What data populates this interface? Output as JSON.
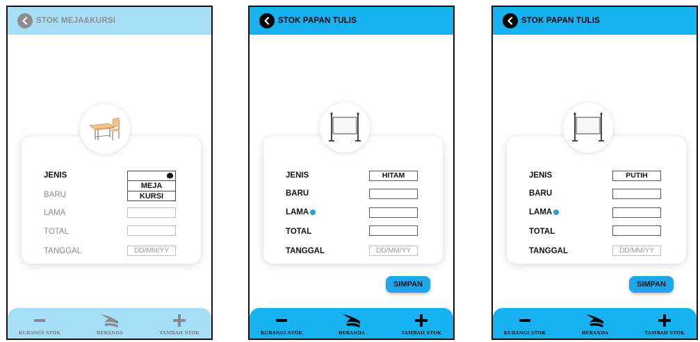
{
  "screens": [
    {
      "title": "STOK MEJA&KURSI",
      "labels": {
        "jenis": "JENIS",
        "baru": "BARU",
        "lama": "LAMA",
        "total": "TOTAL",
        "tanggal": "TANGGAL"
      },
      "jenis_options": [
        "MEJA",
        "KURSI"
      ],
      "tanggal_placeholder": "DD/MM/YY",
      "nav": {
        "kurangi": "KURANGI STOK",
        "beranda": "BERANDA",
        "tambah": "TAMBAH STOK"
      },
      "image_icon": "desk-chair-icon"
    },
    {
      "title": "STOK PAPAN TULIS",
      "labels": {
        "jenis": "JENIS",
        "baru": "BARU",
        "lama": "LAMA",
        "total": "TOTAL",
        "tanggal": "TANGGAL"
      },
      "jenis_value": "HITAM",
      "tanggal_placeholder": "DD/MM/YY",
      "save_label": "SIMPAN",
      "nav": {
        "kurangi": "KURANGI STOK",
        "beranda": "BERANDA",
        "tambah": "TAMBAH STOK"
      },
      "image_icon": "whiteboard-icon"
    },
    {
      "title": "STOK PAPAN TULIS",
      "labels": {
        "jenis": "JENIS",
        "baru": "BARU",
        "lama": "LAMA",
        "total": "TOTAL",
        "tanggal": "TANGGAL"
      },
      "jenis_value": "PUTIH",
      "tanggal_placeholder": "DD/MM/YY",
      "save_label": "SIMPAN",
      "nav": {
        "kurangi": "KURANGI STOK",
        "beranda": "BERANDA",
        "tambah": "TAMBAH STOK"
      },
      "image_icon": "whiteboard-icon"
    }
  ],
  "colors": {
    "accent_faded": "#a6dff7",
    "accent": "#16b2f2",
    "save_button": "#1da6ea",
    "indicator_dot": "#2a9fd6"
  }
}
